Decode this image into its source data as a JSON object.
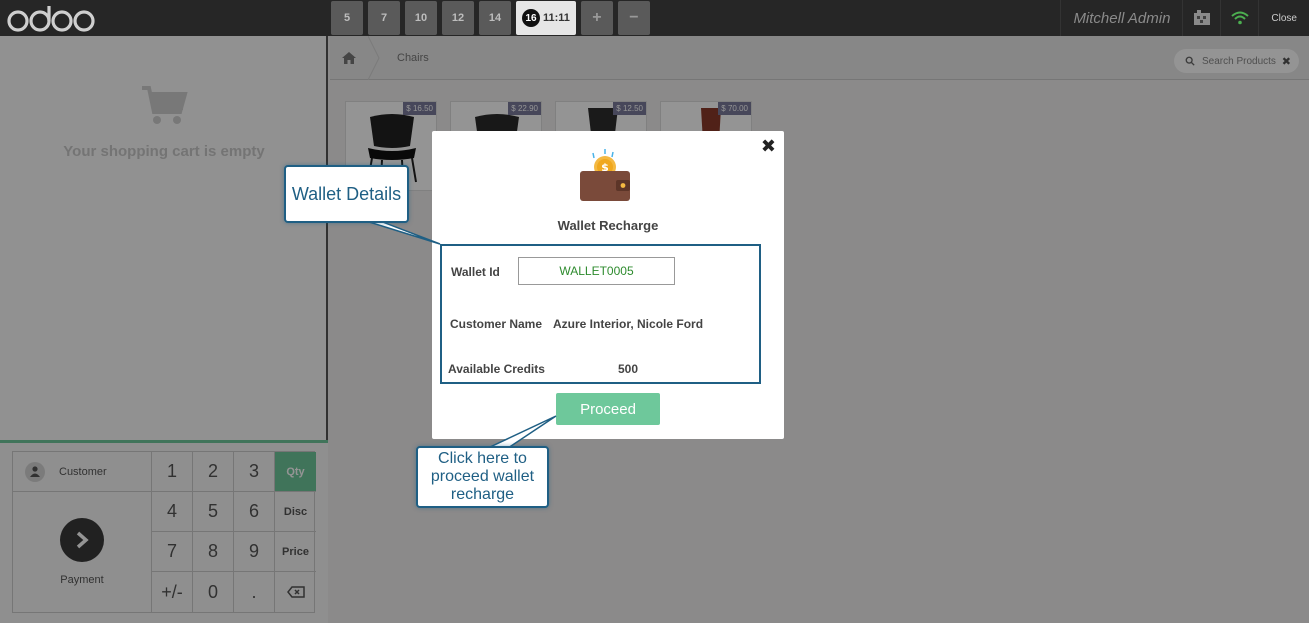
{
  "topbar": {
    "brand": "odoo",
    "orders": [
      {
        "label": "5"
      },
      {
        "label": "7"
      },
      {
        "label": "10"
      },
      {
        "label": "12"
      },
      {
        "label": "14"
      }
    ],
    "active_order": {
      "number": "16",
      "time": "11:11"
    },
    "add_label": "+",
    "remove_label": "−",
    "user": "Mitchell Admin",
    "close_label": "Close"
  },
  "cart": {
    "empty_text": "Your shopping cart is empty"
  },
  "pad": {
    "customer_label": "Customer",
    "payment_label": "Payment",
    "keys": [
      "1",
      "2",
      "3",
      "4",
      "5",
      "6",
      "7",
      "8",
      "9",
      "+/-",
      "0",
      "."
    ],
    "modes": [
      "Qty",
      "Disc",
      "Price"
    ],
    "active_mode": "Qty"
  },
  "products_bar": {
    "breadcrumb": "Chairs",
    "search_placeholder": "Search Products"
  },
  "products": [
    {
      "price": "$ 16.50"
    },
    {
      "price": "$ 22.90"
    },
    {
      "price": "$ 12.50"
    },
    {
      "price": "$ 70.00"
    }
  ],
  "modal": {
    "title": "Wallet Recharge",
    "wallet_id_label": "Wallet Id",
    "wallet_id_value": "WALLET0005",
    "customer_name_label": "Customer Name",
    "customer_name_value": "Azure Interior, Nicole Ford",
    "credits_label": "Available Credits",
    "credits_value": "500",
    "proceed_label": "Proceed"
  },
  "callouts": {
    "wallet_details": "Wallet Details",
    "proceed_line1": "Click here to",
    "proceed_line2": "proceed wallet",
    "proceed_line3": "recharge"
  },
  "colors": {
    "accent_green": "#6ec89b",
    "callout_blue": "#1f5f84",
    "topbar": "#404040"
  }
}
